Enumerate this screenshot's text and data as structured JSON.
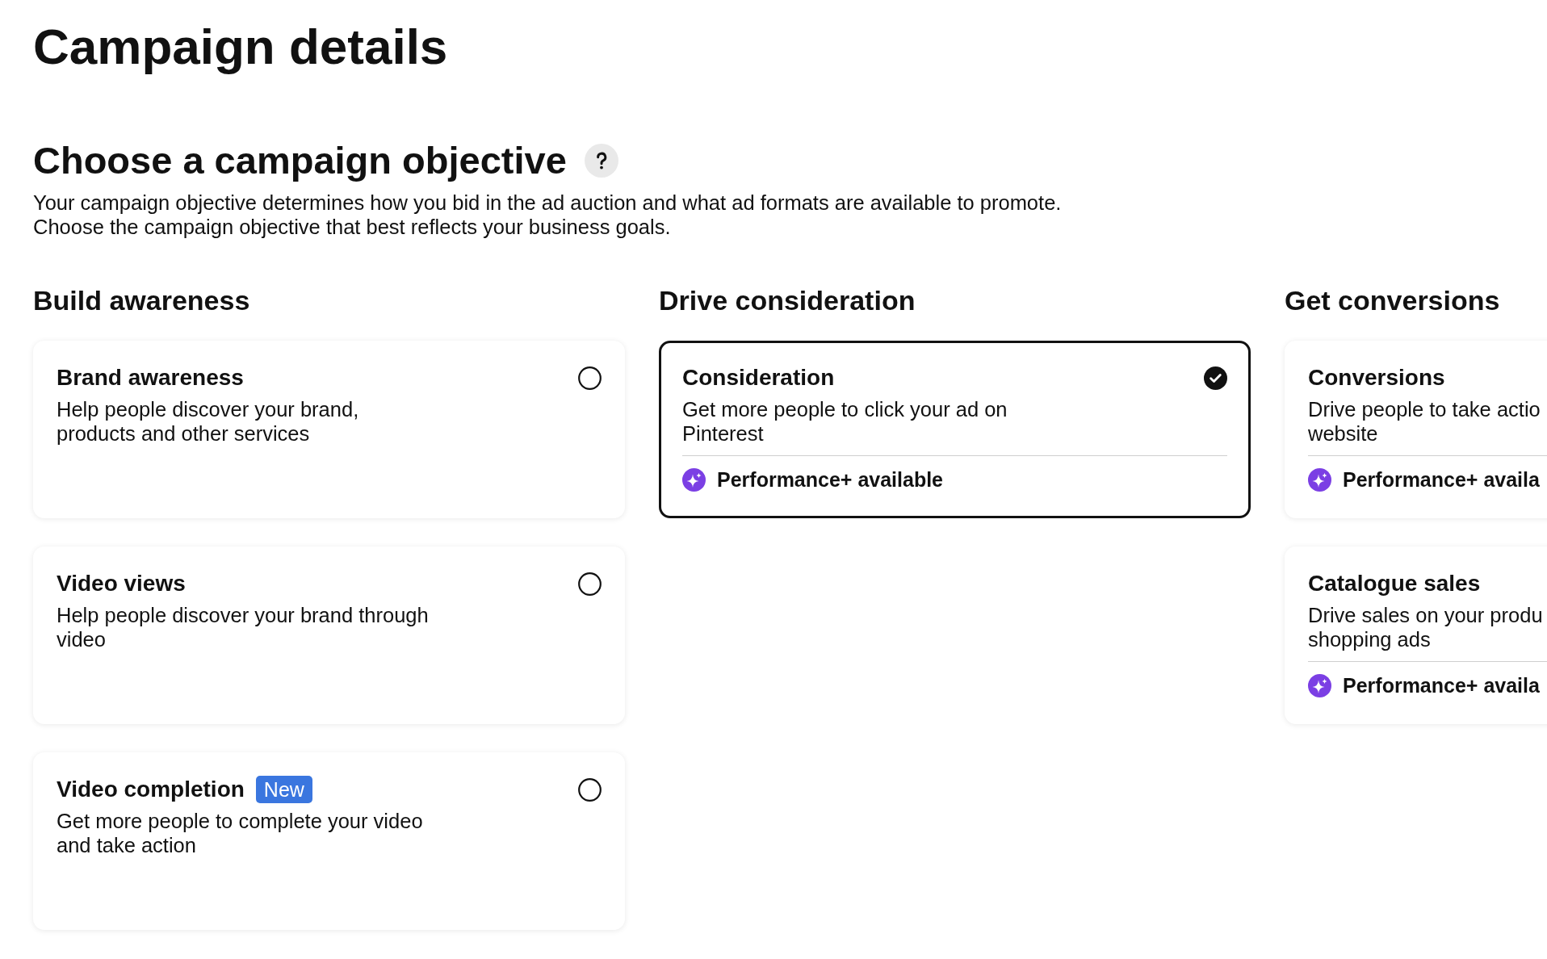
{
  "page": {
    "title": "Campaign details"
  },
  "objective": {
    "heading": "Choose a campaign objective",
    "description": [
      "Your campaign objective determines how you bid in the ad auction and what ad formats are available to promote.",
      "Choose the campaign objective that best reflects your business goals."
    ]
  },
  "columns": [
    {
      "heading": "Build awareness",
      "cards": [
        {
          "title": "Brand awareness",
          "description": [
            "Help people discover your brand,",
            "products and other services"
          ],
          "selected": false
        },
        {
          "title": "Video views",
          "description": [
            "Help people discover your brand through",
            "video"
          ],
          "selected": false
        },
        {
          "title": "Video completion",
          "badge": "New",
          "description": [
            "Get more people to complete your video",
            "and take action"
          ],
          "selected": false
        }
      ]
    },
    {
      "heading": "Drive consideration",
      "cards": [
        {
          "title": "Consideration",
          "description": [
            "Get more people to click your ad on",
            "Pinterest"
          ],
          "selected": true,
          "feature": "Performance+ available"
        }
      ]
    },
    {
      "heading": "Get conversions",
      "cards": [
        {
          "title": "Conversions",
          "description": [
            "Drive people to take actio",
            "website"
          ],
          "feature": "Performance+ availa"
        },
        {
          "title": "Catalogue sales",
          "description": [
            "Drive sales on your produ",
            "shopping ads"
          ],
          "feature": "Performance+ availa"
        }
      ]
    }
  ]
}
